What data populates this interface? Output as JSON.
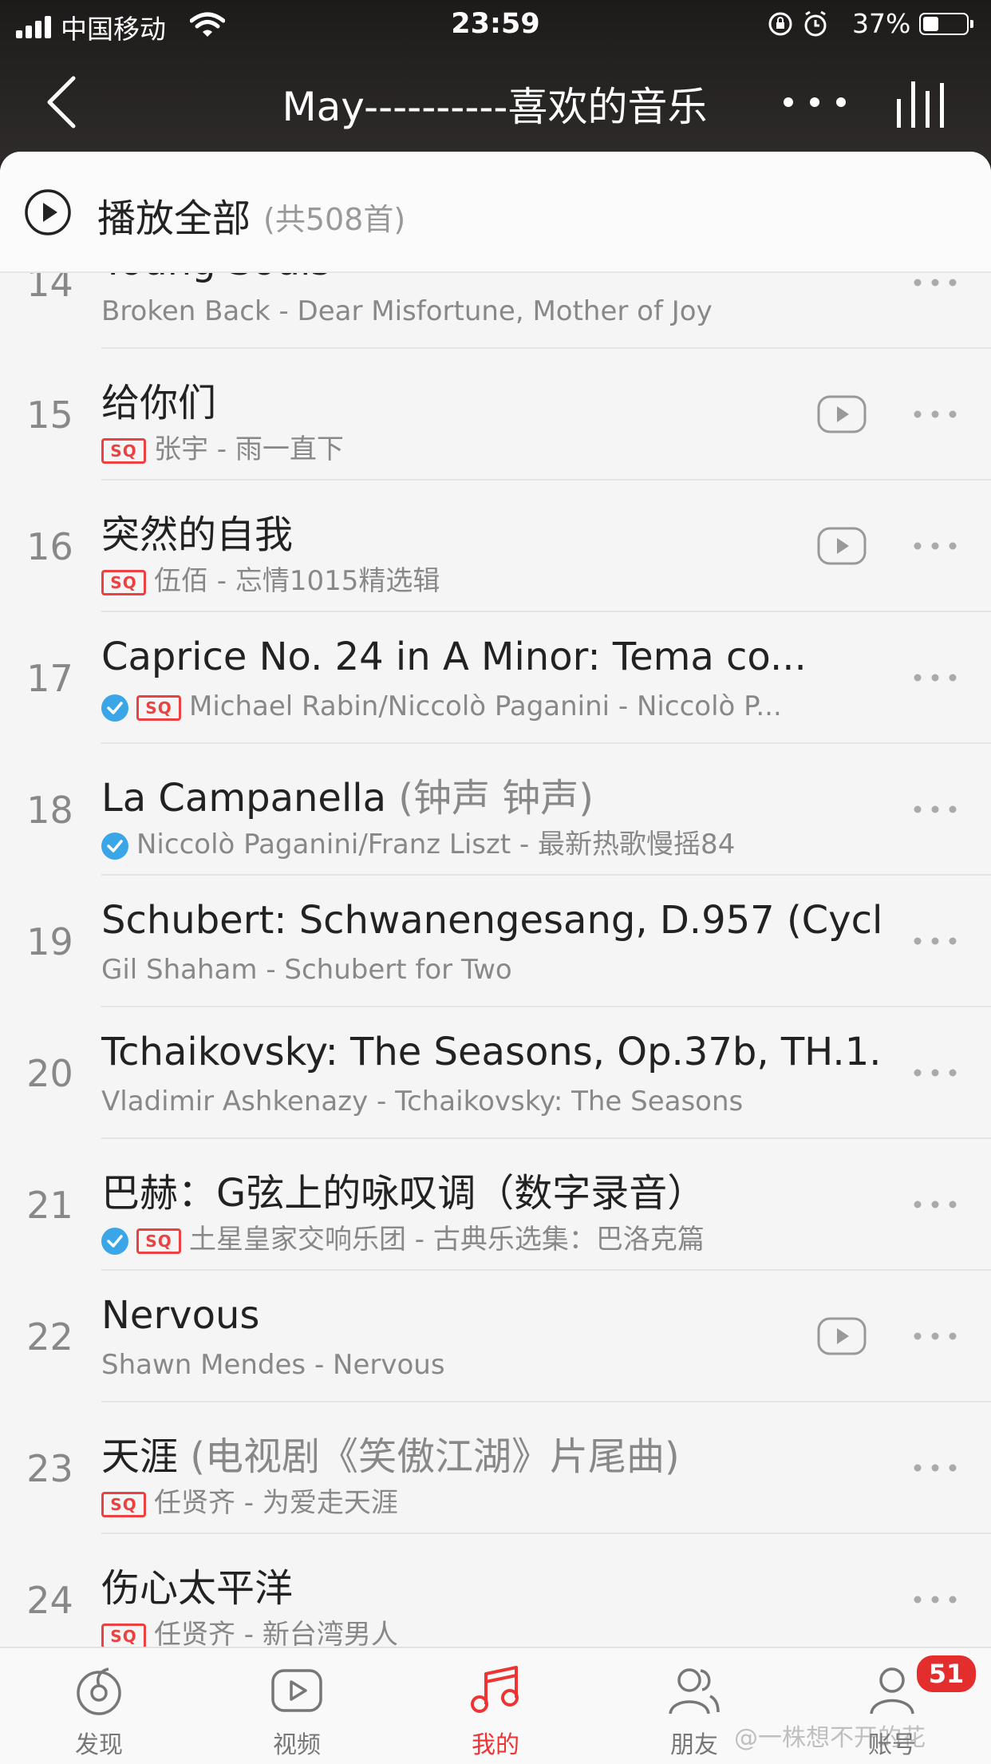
{
  "status_bar": {
    "carrier": "中国移动",
    "time": "23:59",
    "battery_percent": "37%",
    "battery_level": 0.37
  },
  "nav": {
    "title": "May----------喜欢的音乐"
  },
  "play_all": {
    "label": "播放全部",
    "count": "(共508首)"
  },
  "songs": [
    {
      "num": "14",
      "title": "Young Souls",
      "title_paren": "",
      "subtitle": "Broken Back - Dear Misfortune, Mother of Joy",
      "sq": false,
      "verified": false,
      "mv": false
    },
    {
      "num": "15",
      "title": "给你们",
      "title_paren": "",
      "subtitle": "张宇 - 雨一直下",
      "sq": true,
      "verified": false,
      "mv": true
    },
    {
      "num": "16",
      "title": "突然的自我",
      "title_paren": "",
      "subtitle": "伍佰 - 忘情1015精选辑",
      "sq": true,
      "verified": false,
      "mv": true
    },
    {
      "num": "17",
      "title": "Caprice No. 24 in A Minor: Tema co...",
      "title_paren": "",
      "subtitle": "Michael Rabin/Niccolò Paganini - Niccolò P...",
      "sq": true,
      "verified": true,
      "mv": false
    },
    {
      "num": "18",
      "title": "La Campanella",
      "title_paren": "(钟声 钟声)",
      "subtitle": "Niccolò Paganini/Franz Liszt - 最新热歌慢摇84",
      "sq": false,
      "verified": true,
      "mv": false
    },
    {
      "num": "19",
      "title": "Schubert: Schwanengesang, D.957 (Cycl...",
      "title_paren": "",
      "subtitle": "Gil Shaham - Schubert for Two",
      "sq": false,
      "verified": false,
      "mv": false
    },
    {
      "num": "20",
      "title": "Tchaikovsky: The Seasons, Op.37b, TH.1...",
      "title_paren": "",
      "subtitle": "Vladimir Ashkenazy - Tchaikovsky: The Seasons",
      "sq": false,
      "verified": false,
      "mv": false
    },
    {
      "num": "21",
      "title": "巴赫：G弦上的咏叹调（数字录音）",
      "title_paren": "",
      "subtitle": "土星皇家交响乐团 - 古典乐选集：巴洛克篇",
      "sq": true,
      "verified": true,
      "mv": false
    },
    {
      "num": "22",
      "title": "Nervous",
      "title_paren": "",
      "subtitle": "Shawn Mendes - Nervous",
      "sq": false,
      "verified": false,
      "mv": true
    },
    {
      "num": "23",
      "title": "天涯",
      "title_paren": "(电视剧《笑傲江湖》片尾曲)",
      "subtitle": "任贤齐 - 为爱走天涯",
      "sq": true,
      "verified": false,
      "mv": false
    },
    {
      "num": "24",
      "title": "伤心太平洋",
      "title_paren": "",
      "subtitle": "任贤齐 - 新台湾男人",
      "sq": true,
      "verified": false,
      "mv": false
    }
  ],
  "sq_label": "SQ",
  "tabs": [
    {
      "label": "发现",
      "icon": "discover-icon"
    },
    {
      "label": "视频",
      "icon": "video-icon"
    },
    {
      "label": "我的",
      "icon": "music-note-icon",
      "active": true
    },
    {
      "label": "朋友",
      "icon": "friends-icon"
    },
    {
      "label": "账号",
      "icon": "account-icon",
      "badge": "51"
    }
  ],
  "watermark": "@一株想不开的花",
  "colors": {
    "accent": "#e33333",
    "verified": "#3aa6e8",
    "sq": "#ec4141"
  }
}
